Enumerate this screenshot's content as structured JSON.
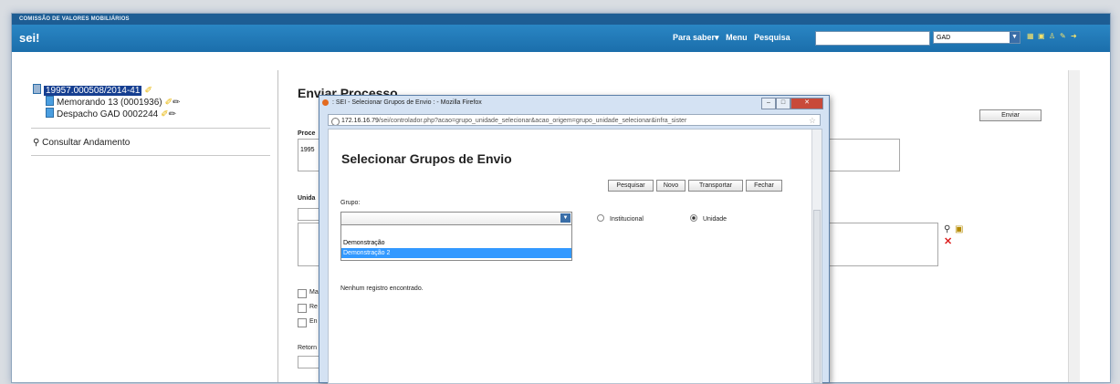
{
  "app": {
    "org_title": "COMISSÃO DE VALORES MOBILIÁRIOS",
    "logo": "sei",
    "logo_mark": "!"
  },
  "nav": {
    "links": [
      "Para saber▾",
      "Menu",
      "Pesquisa"
    ],
    "unit_value": "GAD"
  },
  "tree": {
    "process": "19957.000508/2014-41",
    "docs": [
      {
        "label": "Memorando 13 (0001936)"
      },
      {
        "label": "Despacho GAD 0002244"
      }
    ],
    "consult": "Consultar Andamento"
  },
  "main": {
    "title": "Enviar Processo",
    "send_button": "Enviar",
    "process_label": "Proce",
    "process_value": "1995",
    "unit_label": "Unida",
    "checks": [
      "Ma",
      "Re",
      "En"
    ],
    "return_label": "Retorn"
  },
  "dialog": {
    "window_title": ": SEI - Selecionar Grupos de Envio : - Mozilla Firefox",
    "url_host": "172.16.16.79",
    "url_path": "/sei/controlador.php?acao=grupo_unidade_selecionar&acao_origem=grupo_unidade_selecionar&infra_sister",
    "heading": "Selecionar Grupos de Envio",
    "buttons": [
      "Pesquisar",
      "Novo",
      "Transportar",
      "Fechar"
    ],
    "group_label": "Grupo:",
    "options": [
      "Demonstração",
      "Demonstração 2"
    ],
    "radio_institutional": "Institucional",
    "radio_unit": "Unidade",
    "empty_message": "Nenhum registro encontrado."
  }
}
